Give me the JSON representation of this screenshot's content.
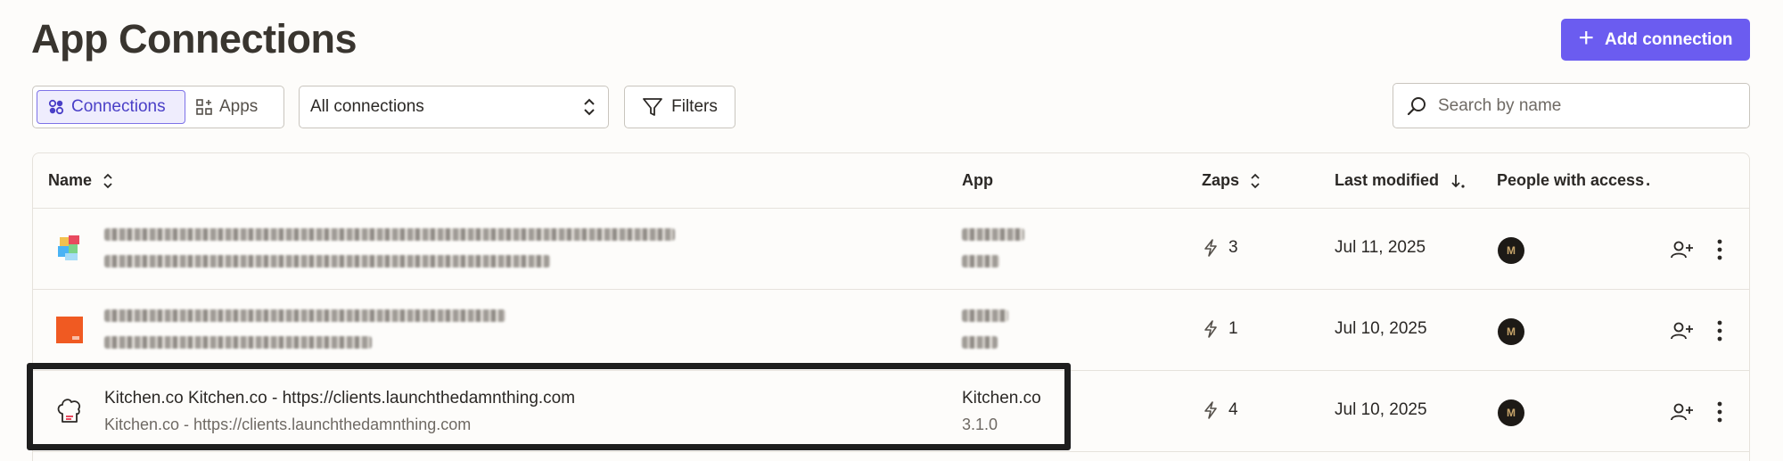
{
  "header": {
    "title": "App Connections",
    "add_button_label": "Add connection"
  },
  "toolbar": {
    "view_tabs": [
      {
        "label": "Connections",
        "icon": "connections-icon",
        "active": true
      },
      {
        "label": "Apps",
        "icon": "apps-grid-icon",
        "active": false
      }
    ],
    "filter_select": {
      "value": "All connections"
    },
    "filters_label": "Filters",
    "search": {
      "placeholder": "Search by name",
      "value": ""
    }
  },
  "table": {
    "columns": {
      "name": "Name",
      "app": "App",
      "zaps": "Zaps",
      "last_modified": "Last modified",
      "people": "People with access"
    },
    "rows": [
      {
        "name": "",
        "sub": "",
        "app": "",
        "version": "",
        "zaps": "3",
        "last_modified": "Jul 11, 2025",
        "icon": "multicolor-app-icon",
        "redacted": true
      },
      {
        "name": "",
        "sub": "",
        "app": "",
        "version": "",
        "zaps": "1",
        "last_modified": "Jul 10, 2025",
        "icon": "orange-app-icon",
        "redacted": true
      },
      {
        "name": "Kitchen.co Kitchen.co - https://clients.launchthedamnthing.com",
        "sub": "Kitchen.co - https://clients.launchthedamnthing.com",
        "app": "Kitchen.co",
        "version": "3.1.0",
        "zaps": "4",
        "last_modified": "Jul 10, 2025",
        "icon": "chef-hat-icon",
        "redacted": false
      }
    ]
  },
  "colors": {
    "accent": "#6b5cf0",
    "background": "#fdfcfa",
    "border": "#e6e2dc"
  }
}
